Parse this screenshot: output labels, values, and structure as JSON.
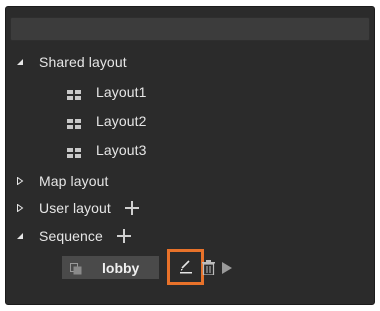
{
  "tree": {
    "shared_layout": {
      "label": "Shared layout",
      "expanded": true,
      "children": [
        {
          "label": "Layout1",
          "icon": "grid-icon"
        },
        {
          "label": "Layout2",
          "icon": "grid-icon"
        },
        {
          "label": "Layout3",
          "icon": "grid-icon"
        }
      ]
    },
    "map_layout": {
      "label": "Map layout",
      "expanded": false
    },
    "user_layout": {
      "label": "User layout",
      "expanded": false,
      "add_icon": "plus-icon"
    },
    "sequence": {
      "label": "Sequence",
      "expanded": true,
      "add_icon": "plus-icon",
      "items": [
        {
          "label": "lobby",
          "icon": "copy-icon",
          "actions": [
            "pencil-icon",
            "trash-icon",
            "play-icon"
          ]
        }
      ]
    }
  },
  "colors": {
    "panel_bg": "#2b2b2b",
    "highlight": "#e8722a",
    "text": "#e6e6e6"
  }
}
